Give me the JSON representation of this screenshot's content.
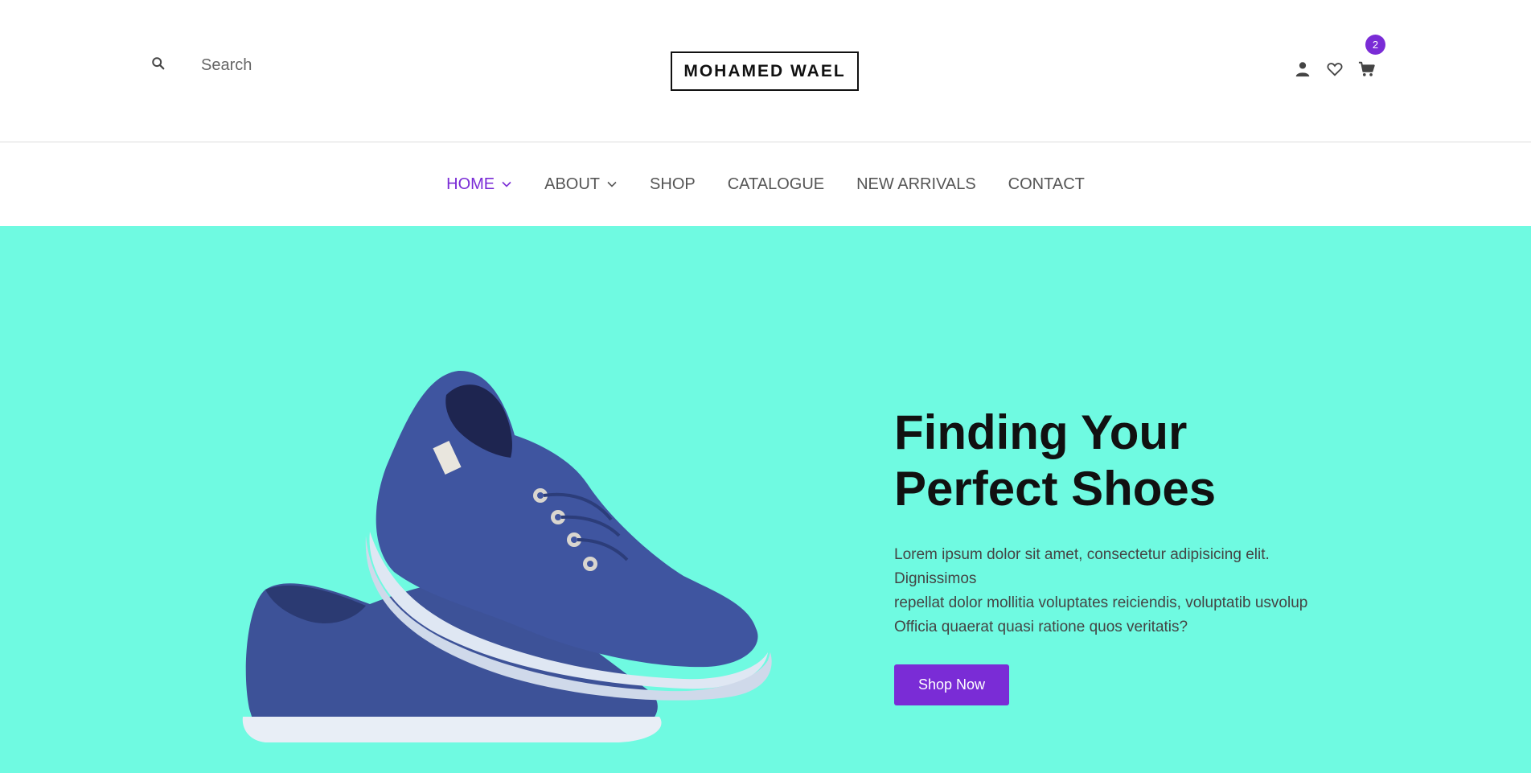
{
  "header": {
    "search_placeholder": "Search",
    "logo": "MOHAMED WAEL",
    "cart_count": "2",
    "icons": [
      "search-icon",
      "user-icon",
      "heart-icon",
      "cart-icon"
    ]
  },
  "nav": {
    "items": [
      {
        "label": "HOME",
        "has_dropdown": true,
        "active": true
      },
      {
        "label": "ABOUT",
        "has_dropdown": true,
        "active": false
      },
      {
        "label": "SHOP",
        "has_dropdown": false,
        "active": false
      },
      {
        "label": "CATALOGUE",
        "has_dropdown": false,
        "active": false
      },
      {
        "label": "NEW ARRIVALS",
        "has_dropdown": false,
        "active": false
      },
      {
        "label": "CONTACT",
        "has_dropdown": false,
        "active": false
      }
    ]
  },
  "hero": {
    "title_line1": "Finding Your",
    "title_line2": "Perfect Shoes",
    "desc_lines": [
      "Lorem ipsum dolor sit amet, consectetur adipisicing elit.",
      "Dignissimos",
      "repellat dolor mollitia voluptates reiciendis, voluptatib usvolup",
      "Officia quaerat quasi ratione quos veritatis?"
    ],
    "cta_label": "Shop Now"
  },
  "colors": {
    "accent": "#7a2cd6",
    "hero_bg": "#6ffae1",
    "nav_text": "#555555",
    "shoe": "#3a4f96"
  }
}
